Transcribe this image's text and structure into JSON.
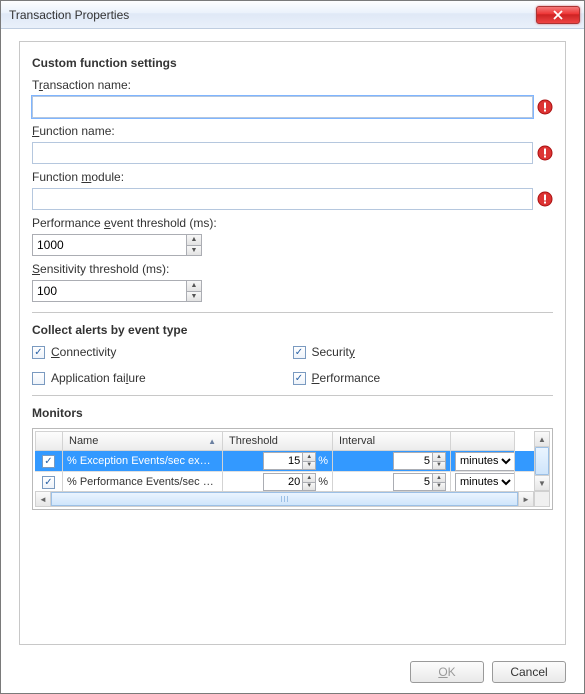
{
  "window": {
    "title": "Transaction Properties"
  },
  "sections": {
    "custom": "Custom function settings",
    "alerts": "Collect alerts by event type",
    "monitors": "Monitors"
  },
  "fields": {
    "transaction_name": {
      "label_pre": "T",
      "label_hot": "r",
      "label_post": "ansaction name:",
      "value": ""
    },
    "function_name": {
      "label_pre": "",
      "label_hot": "F",
      "label_post": "unction name:",
      "value": ""
    },
    "function_module": {
      "label_pre": "Function ",
      "label_hot": "m",
      "label_post": "odule:",
      "value": ""
    },
    "perf_threshold": {
      "label_pre": "Performance ",
      "label_hot": "e",
      "label_post": "vent threshold (ms):",
      "value": "1000"
    },
    "sens_threshold": {
      "label_pre": "",
      "label_hot": "S",
      "label_post": "ensitivity threshold (ms):",
      "value": "100"
    }
  },
  "alerts": {
    "connectivity": {
      "label": "Connectivity",
      "hotkey_pre": "",
      "hotkey_hot": "C",
      "hotkey_post": "onnectivity",
      "checked": true
    },
    "security": {
      "label": "Security",
      "hotkey_pre": "Securit",
      "hotkey_hot": "y",
      "hotkey_post": "",
      "checked": true
    },
    "appfail": {
      "label": "Application failure",
      "hotkey_pre": "Application fai",
      "hotkey_hot": "l",
      "hotkey_post": "ure",
      "checked": false
    },
    "performance": {
      "label": "Performance",
      "hotkey_pre": "",
      "hotkey_hot": "P",
      "hotkey_post": "erformance",
      "checked": true
    }
  },
  "monitors": {
    "headers": {
      "name": "Name",
      "threshold": "Threshold",
      "interval": "Interval"
    },
    "rows": [
      {
        "checked": true,
        "name": "% Exception Events/sec ex…",
        "threshold": "15",
        "unit_pct": "%",
        "interval": "5",
        "interval_unit": "minutes",
        "selected": true
      },
      {
        "checked": true,
        "name": "% Performance Events/sec …",
        "threshold": "20",
        "unit_pct": "%",
        "interval": "5",
        "interval_unit": "minutes",
        "selected": false
      }
    ]
  },
  "buttons": {
    "ok_pre": "O",
    "ok_hot": "K",
    "ok_post": "",
    "cancel": "Cancel"
  }
}
